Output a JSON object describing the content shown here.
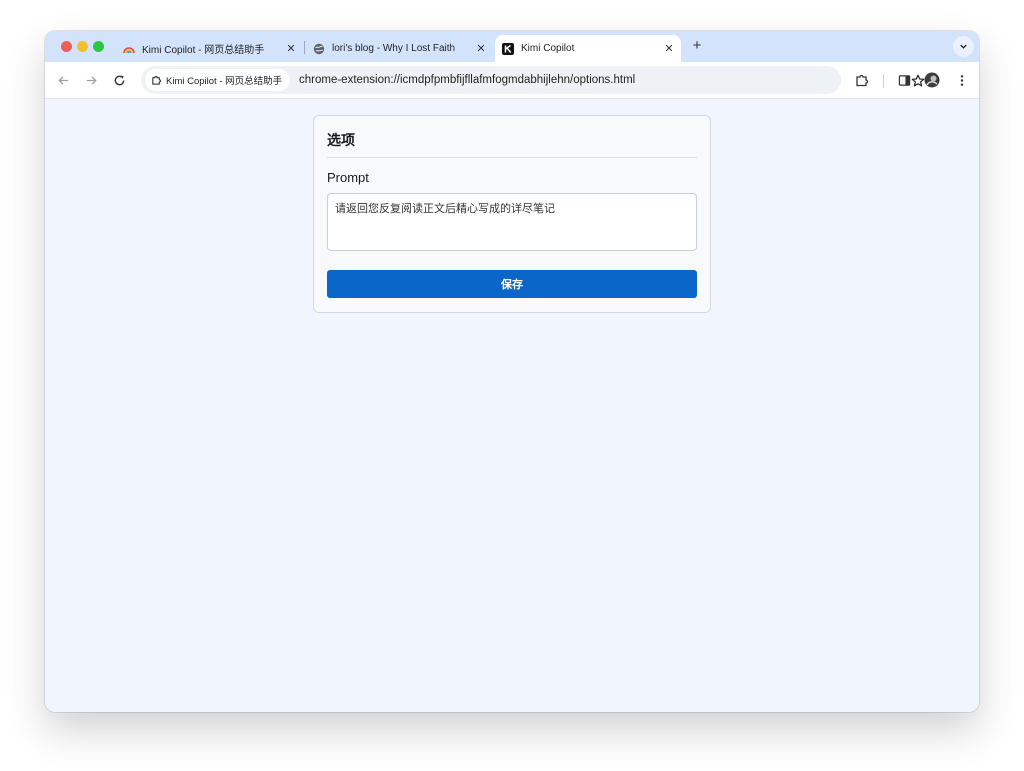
{
  "tabs": [
    {
      "title": "Kimi Copilot - 网页总结助手",
      "favicon": "rainbow-icon",
      "close": "✕"
    },
    {
      "title": "lori's blog - Why I Lost Faith",
      "favicon": "globe-icon",
      "close": "✕"
    },
    {
      "title": "Kimi Copilot",
      "favicon": "kimi-k-icon",
      "close": "✕",
      "active": true
    }
  ],
  "new_tab_label": "+",
  "toolbar": {
    "site_chip": "Kimi Copilot - 网页总结助手",
    "url": "chrome-extension://icmdpfpmbfijfllafmfogmdabhijlehn/options.html"
  },
  "options": {
    "title": "选项",
    "prompt_label": "Prompt",
    "prompt_value": "请返回您反复阅读正文后精心写成的详尽笔记",
    "save_label": "保存"
  },
  "colors": {
    "accent": "#0a66c8",
    "tabstrip": "#d4e3fc",
    "page_bg": "#f1f5fd"
  }
}
